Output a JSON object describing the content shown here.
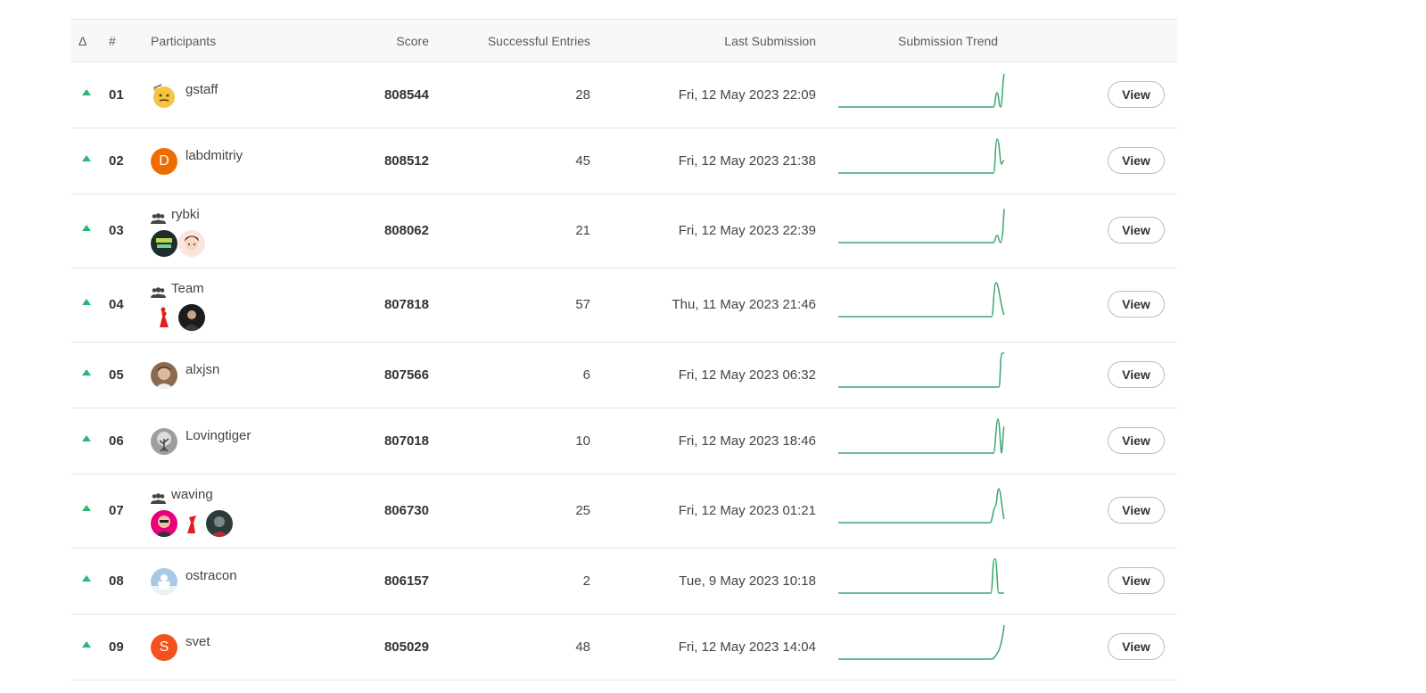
{
  "colors": {
    "trend_line": "#3aa66d",
    "delta_up": "#2bb673",
    "avatar_orange": "#ef6c00",
    "avatar_red_orange": "#f4511e"
  },
  "header": {
    "delta": "Δ",
    "rank": "#",
    "participants": "Participants",
    "score": "Score",
    "entries": "Successful Entries",
    "last": "Last Submission",
    "trend": "Submission Trend"
  },
  "view_label": "View",
  "rows": [
    {
      "rank": "01",
      "name": "gstaff",
      "team": false,
      "score": "808544",
      "entries": "28",
      "last": "Fri, 12 May 2023 22:09",
      "avatar_letter": ""
    },
    {
      "rank": "02",
      "name": "labdmitriy",
      "team": false,
      "score": "808512",
      "entries": "45",
      "last": "Fri, 12 May 2023 21:38",
      "avatar_letter": "D"
    },
    {
      "rank": "03",
      "name": "rybki",
      "team": true,
      "score": "808062",
      "entries": "21",
      "last": "Fri, 12 May 2023 22:39",
      "avatar_letter": ""
    },
    {
      "rank": "04",
      "name": "Team",
      "team": true,
      "score": "807818",
      "entries": "57",
      "last": "Thu, 11 May 2023 21:46",
      "avatar_letter": ""
    },
    {
      "rank": "05",
      "name": "alxjsn",
      "team": false,
      "score": "807566",
      "entries": "6",
      "last": "Fri, 12 May 2023 06:32",
      "avatar_letter": ""
    },
    {
      "rank": "06",
      "name": "Lovingtiger",
      "team": false,
      "score": "807018",
      "entries": "10",
      "last": "Fri, 12 May 2023 18:46",
      "avatar_letter": ""
    },
    {
      "rank": "07",
      "name": "waving",
      "team": true,
      "score": "806730",
      "entries": "25",
      "last": "Fri, 12 May 2023 01:21",
      "avatar_letter": ""
    },
    {
      "rank": "08",
      "name": "ostracon",
      "team": false,
      "score": "806157",
      "entries": "2",
      "last": "Tue, 9 May 2023 10:18",
      "avatar_letter": ""
    },
    {
      "rank": "09",
      "name": "svet",
      "team": false,
      "score": "805029",
      "entries": "48",
      "last": "Fri, 12 May 2023 14:04",
      "avatar_letter": "S"
    }
  ]
}
